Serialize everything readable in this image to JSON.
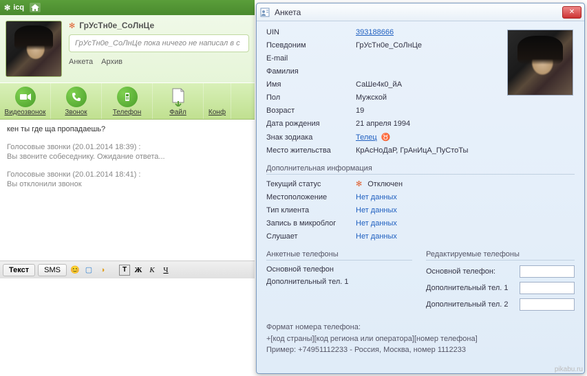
{
  "icq": {
    "app_name": "icq",
    "user_name": "ГрУсТн0е_СоЛнЦе",
    "status_text": "ГрУсТн0е_СоЛнЦе пока ничего не написал в с",
    "links": {
      "profile": "Анкета",
      "archive": "Архив"
    },
    "toolbar": {
      "video": "Видеозвонок",
      "call": "Звонок",
      "phone": "Телефон",
      "file": "Файл",
      "conf": "Конф"
    },
    "chat": {
      "line1": "кен ты где ща пропадаешь?",
      "block1_meta": "Голосовые звонки (20.01.2014 18:39) :",
      "block1_text": "Вы звоните собеседнику. Ожидание ответа...",
      "block2_meta": "Голосовые звонки (20.01.2014 18:41) :",
      "block2_text": "Вы отклонили звонок"
    },
    "input_tabs": {
      "text": "Текст",
      "sms": "SMS"
    }
  },
  "profile": {
    "title": "Анкета",
    "labels": {
      "uin": "UIN",
      "nick": "Псевдоним",
      "email": "E-mail",
      "surname": "Фамилия",
      "name": "Имя",
      "gender": "Пол",
      "age": "Возраст",
      "birth": "Дата рождения",
      "zodiac": "Знак зодиака",
      "location": "Место жительства"
    },
    "values": {
      "uin": "393188666",
      "nick": "ГрУсТн0е_СоЛнЦе",
      "email": "",
      "surname": "",
      "name": "СаШе4к0_йА",
      "gender": "Мужской",
      "age": "19",
      "birth": "21 апреля 1994",
      "zodiac": "Телец",
      "location": "КрАсНоДаР, ГрАнИцА_ПуСтоТы"
    },
    "extra": {
      "title": "Дополнительная информация",
      "status_label": "Текущий статус",
      "status_value": "Отключен",
      "loc_label": "Местоположение",
      "client_label": "Тип клиента",
      "microblog_label": "Запись в микроблог",
      "listening_label": "Слушает",
      "nodata": "Нет данных"
    },
    "phones": {
      "left_title": "Анкетные телефоны",
      "right_title": "Редактируемые телефоны",
      "main": "Основной телефон",
      "main_colon": "Основной телефон:",
      "add1": "Дополнительный тел. 1",
      "add2": "Дополнительный тел. 2"
    },
    "format": {
      "line1": "Формат номера телефона:",
      "line2": "+[код страны][код региона или оператора][номер телефона]",
      "line3": "Пример: +74951112233 - Россия, Москва, номер 1112233"
    }
  },
  "watermark": "pikabu.ru"
}
